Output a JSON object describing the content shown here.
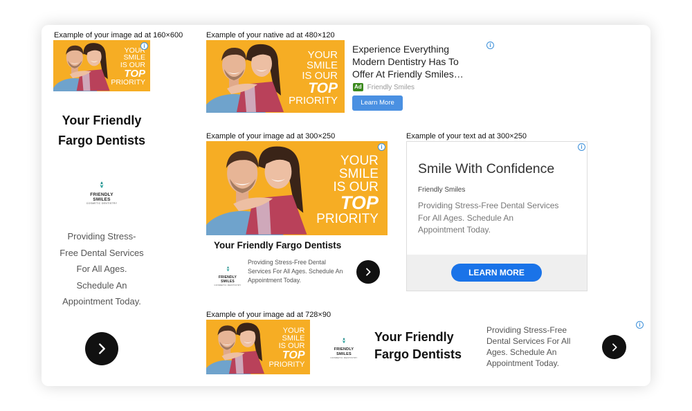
{
  "colors": {
    "promo_bg": "#f6ad24",
    "accent_blue": "#1a73e8",
    "info_blue": "#3b8fd9",
    "ad_badge_green": "#3c8a1e"
  },
  "promo": {
    "line1": "YOUR",
    "line2": "SMILE",
    "line3": "IS OUR",
    "line4": "TOP",
    "line5": "PRIORITY"
  },
  "logo": {
    "name1": "FRIENDLY",
    "name2": "SMILES",
    "sub": "COSMETIC DENTISTRY"
  },
  "info_glyph": "i",
  "ad160": {
    "caption": "Example of your image ad at 160×600",
    "headline1": "Your Friendly",
    "headline2": "Fargo Dentists",
    "desc1": "Providing Stress-",
    "desc2": "Free Dental Services",
    "desc3": "For All Ages.",
    "desc4": "Schedule An",
    "desc5": "Appointment Today."
  },
  "native": {
    "caption": "Example of your native ad at 480×120",
    "title1": "Experience Everything",
    "title2": "Modern Dentistry Has To",
    "title3": "Offer At Friendly Smiles…",
    "badge": "Ad",
    "advertiser": "Friendly Smiles",
    "button": "Learn More"
  },
  "image300": {
    "caption": "Example of your image ad at 300×250",
    "headline": "Your Friendly Fargo Dentists",
    "desc1": "Providing Stress-Free Dental",
    "desc2": "Services For All Ages. Schedule An",
    "desc3": "Appointment Today."
  },
  "text300": {
    "caption": "Example of your text ad at 300×250",
    "headline": "Smile With Confidence",
    "advertiser": "Friendly Smiles",
    "desc1": "Providing Stress-Free Dental Services",
    "desc2": "For All Ages. Schedule An",
    "desc3": "Appointment Today.",
    "button": "LEARN MORE"
  },
  "ad728": {
    "caption": "Example of your image ad at 728×90",
    "headline1": "Your Friendly",
    "headline2": "Fargo Dentists",
    "desc1": "Providing Stress-Free",
    "desc2": "Dental Services For All",
    "desc3": "Ages. Schedule An",
    "desc4": "Appointment Today."
  }
}
